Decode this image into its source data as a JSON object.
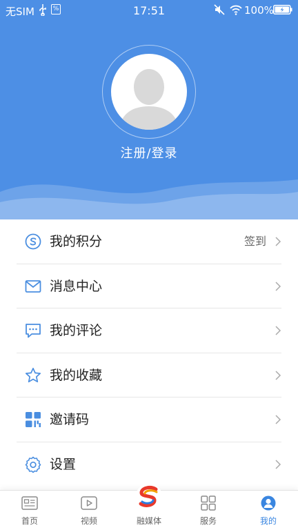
{
  "status_bar": {
    "carrier": "无SIM",
    "time": "17:51",
    "battery": "100%"
  },
  "profile": {
    "login_text": "注册/登录"
  },
  "menu": {
    "items": [
      {
        "label": "我的积分",
        "icon": "points-icon",
        "extra": "签到"
      },
      {
        "label": "消息中心",
        "icon": "mail-icon",
        "extra": ""
      },
      {
        "label": "我的评论",
        "icon": "comment-icon",
        "extra": ""
      },
      {
        "label": "我的收藏",
        "icon": "star-icon",
        "extra": ""
      },
      {
        "label": "邀请码",
        "icon": "qr-code-icon",
        "extra": ""
      },
      {
        "label": "设置",
        "icon": "gear-icon",
        "extra": ""
      }
    ]
  },
  "tabbar": {
    "tabs": [
      {
        "label": "首页",
        "icon": "home-news-icon",
        "active": false
      },
      {
        "label": "视频",
        "icon": "video-icon",
        "active": false
      },
      {
        "label": "融媒体",
        "icon": "media-logo-icon",
        "active": false
      },
      {
        "label": "服务",
        "icon": "grid-icon",
        "active": false
      },
      {
        "label": "我的",
        "icon": "user-icon",
        "active": true
      }
    ]
  },
  "colors": {
    "header_bg": "#4d8fe5",
    "accent": "#3a86e0",
    "icon_blue": "#4a8ee0"
  }
}
